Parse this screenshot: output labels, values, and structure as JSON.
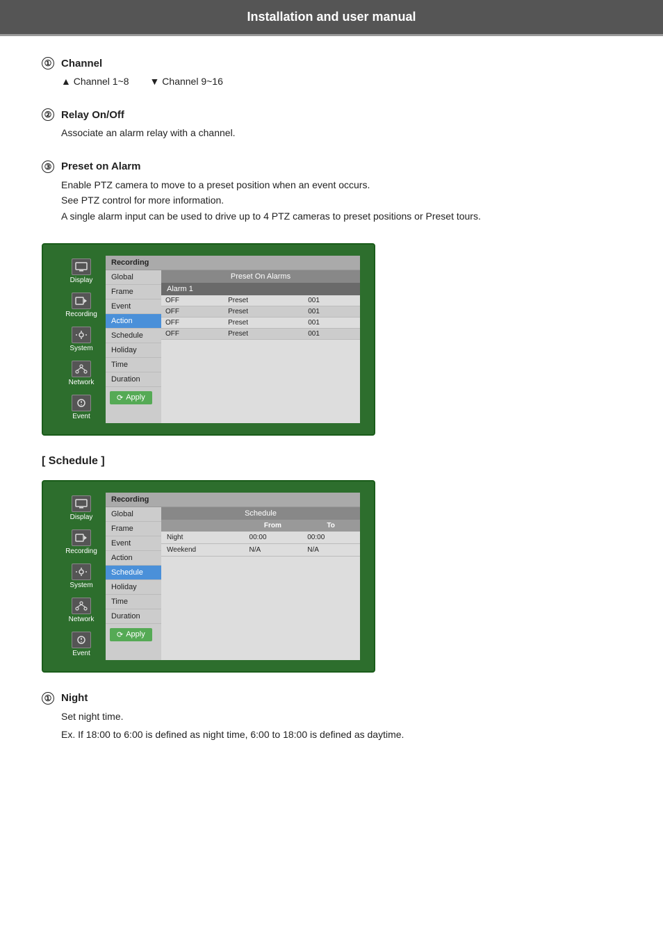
{
  "header": {
    "title": "Installation and user manual"
  },
  "sections": {
    "channel": {
      "num": "①",
      "title": "Channel",
      "arrow_up": "Channel 1~8",
      "arrow_down": "Channel 9~16"
    },
    "relay": {
      "num": "②",
      "title": "Relay On/Off",
      "desc": "Associate an alarm relay with a channel."
    },
    "preset": {
      "num": "③",
      "title": "Preset on Alarm",
      "lines": [
        "Enable PTZ camera to move to a preset position when an event occurs.",
        "See PTZ control for more information.",
        "A single alarm input can be used to drive up to 4 PTZ cameras to preset positions or Preset tours."
      ]
    }
  },
  "dvr_panel_1": {
    "menu_header": "Recording",
    "menu_items": [
      {
        "label": "Global",
        "active": false
      },
      {
        "label": "Frame",
        "active": false
      },
      {
        "label": "Event",
        "active": false
      },
      {
        "label": "Action",
        "active": true
      },
      {
        "label": "Schedule",
        "active": false
      },
      {
        "label": "Holiday",
        "active": false
      },
      {
        "label": "Time",
        "active": false
      },
      {
        "label": "Duration",
        "active": false
      }
    ],
    "apply_label": "Apply",
    "content_header": "Preset On Alarms",
    "alarm_label": "Alarm 1",
    "table_cols": [
      "",
      "Preset",
      ""
    ],
    "table_rows": [
      {
        "col1": "OFF",
        "col2": "Preset",
        "col3": "001"
      },
      {
        "col1": "OFF",
        "col2": "Preset",
        "col3": "001"
      },
      {
        "col1": "OFF",
        "col2": "Preset",
        "col3": "001"
      },
      {
        "col1": "OFF",
        "col2": "Preset",
        "col3": "001"
      }
    ],
    "sidebar": [
      {
        "label": "Display",
        "icon": "display"
      },
      {
        "label": "Recording",
        "icon": "recording"
      },
      {
        "label": "System",
        "icon": "system"
      },
      {
        "label": "Network",
        "icon": "network"
      },
      {
        "label": "Event",
        "icon": "event"
      }
    ]
  },
  "schedule_section": {
    "title": "[ Schedule ]",
    "menu_header": "Recording",
    "menu_items": [
      {
        "label": "Global",
        "active": false
      },
      {
        "label": "Frame",
        "active": false
      },
      {
        "label": "Event",
        "active": false
      },
      {
        "label": "Action",
        "active": false
      },
      {
        "label": "Schedule",
        "active": true
      },
      {
        "label": "Holiday",
        "active": false
      },
      {
        "label": "Time",
        "active": false
      },
      {
        "label": "Duration",
        "active": false
      }
    ],
    "apply_label": "Apply",
    "content_header": "Schedule",
    "table_headers": [
      "",
      "From",
      "To"
    ],
    "table_rows": [
      {
        "label": "Night",
        "from": "00:00",
        "to": "00:00"
      },
      {
        "label": "Weekend",
        "from": "N/A",
        "to": "N/A"
      }
    ],
    "sidebar": [
      {
        "label": "Display",
        "icon": "display"
      },
      {
        "label": "Recording",
        "icon": "recording"
      },
      {
        "label": "System",
        "icon": "system"
      },
      {
        "label": "Network",
        "icon": "network"
      },
      {
        "label": "Event",
        "icon": "event"
      }
    ]
  },
  "night_section": {
    "num": "①",
    "title": "Night",
    "lines": [
      "Set night time.",
      "Ex. If 18:00 to 6:00 is defined as night time, 6:00 to 18:00 is defined as daytime."
    ]
  }
}
